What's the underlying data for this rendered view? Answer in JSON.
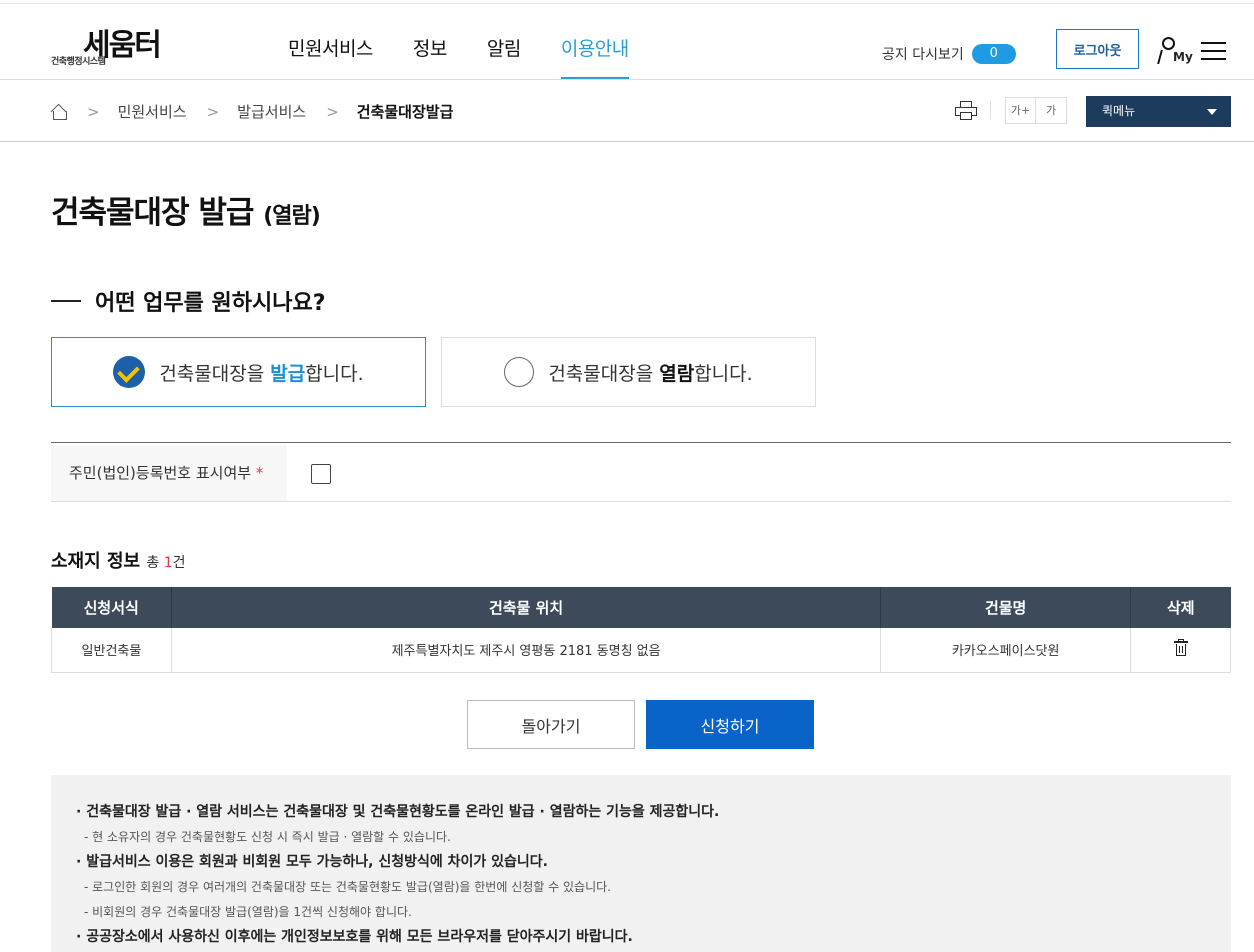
{
  "header": {
    "logo_main": "세움터",
    "logo_sub": "건축행정시스템",
    "nav": [
      "민원서비스",
      "정보",
      "알림",
      "이용안내"
    ],
    "notice_label": "공지 다시보기",
    "notice_count": "0",
    "logout_label": "로그아웃",
    "my_label": "My"
  },
  "breadcrumb": {
    "items": [
      "민원서비스",
      "발급서비스",
      "건축물대장발급"
    ],
    "separator": ">"
  },
  "toolbar": {
    "font_up": "가+",
    "font_down": "가",
    "quick_menu": "퀵메뉴"
  },
  "page": {
    "title": "건축물대장 발급",
    "title_sub": "(열람)",
    "question": "어떤 업무를 원하시나요?"
  },
  "options": [
    {
      "pre": "건축물대장을 ",
      "hl": "발급",
      "post": "합니다."
    },
    {
      "pre": "건축물대장을 ",
      "hl": "열람",
      "post": "합니다."
    }
  ],
  "form": {
    "label": "주민(법인)등록번호 표시여부",
    "required": "*"
  },
  "section": {
    "title": "소재지 정보",
    "total_pre": "총 ",
    "total_num": "1",
    "total_post": "건"
  },
  "table": {
    "headers": [
      "신청서식",
      "건축물 위치",
      "건물명",
      "삭제"
    ],
    "rows": [
      [
        "일반건축물",
        "제주특별자치도 제주시 영평동 2181 동명칭 없음",
        "카카오스페이스닷원"
      ]
    ]
  },
  "buttons": {
    "back": "돌아가기",
    "apply": "신청하기"
  },
  "info": [
    {
      "type": "b",
      "text": "· 건축물대장 발급 · 열람 서비스는 건축물대장 및 건축물현황도를 온라인 발급 · 열람하는 기능을 제공합니다."
    },
    {
      "type": "s",
      "text": "- 현 소유자의 경우 건축물현황도 신청 시 즉시 발급 · 열람할 수 있습니다."
    },
    {
      "type": "b",
      "text": "· 발급서비스 이용은 회원과 비회원 모두 가능하나, 신청방식에 차이가 있습니다."
    },
    {
      "type": "s",
      "text": "- 로그인한 회원의 경우 여러개의 건축물대장 또는 건축물현황도 발급(열람)을 한번에 신청할 수 있습니다."
    },
    {
      "type": "s",
      "text": "- 비회원의 경우 건축물대장 발급(열람)을 1건씩 신청해야 합니다."
    },
    {
      "type": "b",
      "text": "· 공공장소에서 사용하신 이후에는 개인정보보호를 위해 모든 브라우저를 닫아주시기 바랍니다."
    }
  ]
}
